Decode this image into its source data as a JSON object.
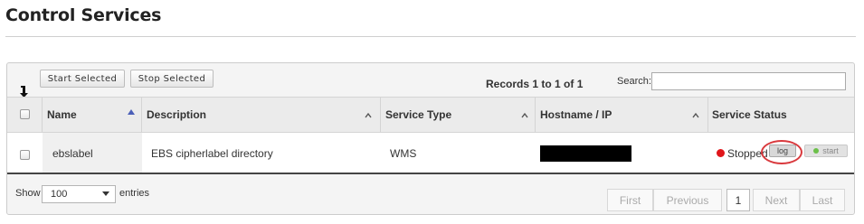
{
  "page": {
    "title": "Control Services"
  },
  "toolbar": {
    "start_selected_label": "Start Selected",
    "stop_selected_label": "Stop Selected",
    "records_info": "Records 1 to 1 of 1",
    "search_label": "Search:",
    "search_value": ""
  },
  "table": {
    "columns": [
      "Name",
      "Description",
      "Service Type",
      "Hostname / IP",
      "Service Status"
    ],
    "rows": [
      {
        "name": "ebslabel",
        "description": "EBS cipherlabel directory",
        "service_type": "WMS",
        "hostname": "",
        "status": "Stopped",
        "log_label": "log",
        "start_label": "start"
      }
    ]
  },
  "footer": {
    "show_label": "Show",
    "page_size": "100",
    "entries_label": "entries",
    "pagination": {
      "first": "First",
      "previous": "Previous",
      "current_page": "1",
      "next": "Next",
      "last": "Last"
    }
  },
  "colors": {
    "status_stopped": "#e0161b",
    "start_indicator": "#6cc04a",
    "highlight_ring": "#d9393d"
  }
}
